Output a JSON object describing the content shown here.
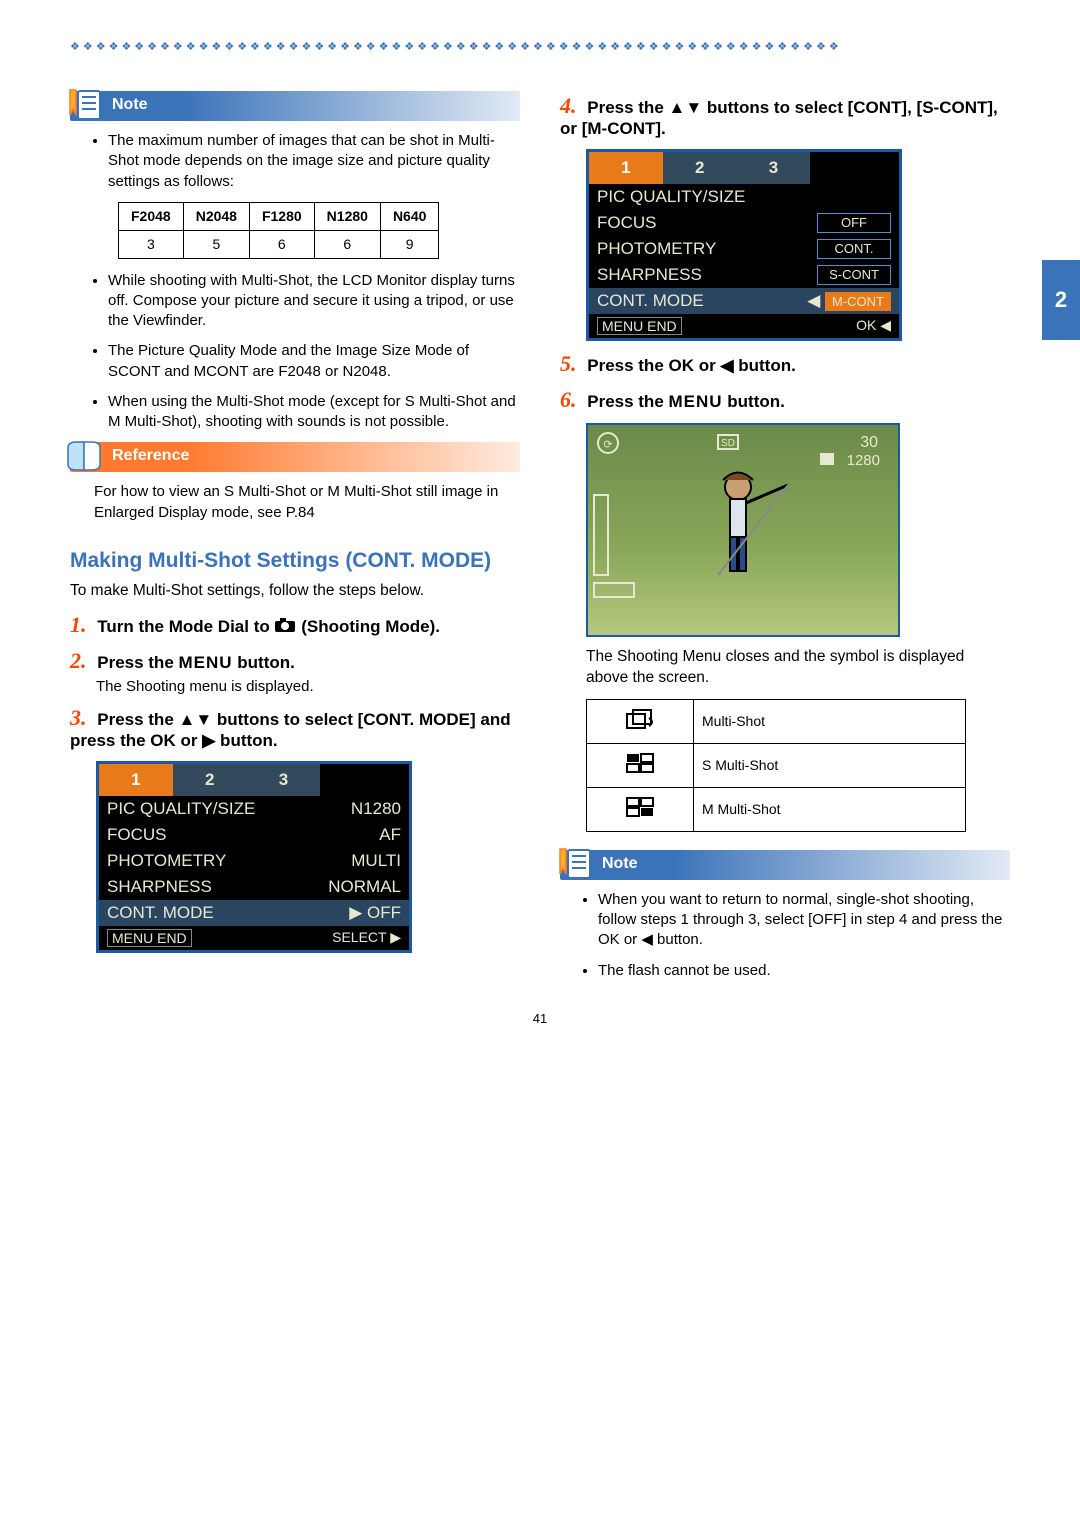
{
  "page_number": "41",
  "section_tab": "2",
  "note1": {
    "label": "Note",
    "items": [
      "The maximum number of images that can be shot in Multi-Shot mode depends on the image size and picture quality settings as follows:",
      "While shooting with Multi-Shot, the LCD Monitor display turns off. Compose your picture and secure it using a tripod, or use the Viewfinder.",
      "The Picture Quality Mode and the Image Size Mode of SCONT and MCONT are F2048 or N2048.",
      "When using the Multi-Shot mode (except for S Multi-Shot and M Multi-Shot), shooting with sounds is not possible."
    ],
    "table_headers": [
      "F2048",
      "N2048",
      "F1280",
      "N1280",
      "N640"
    ],
    "table_values": [
      "3",
      "5",
      "6",
      "6",
      "9"
    ]
  },
  "reference": {
    "label": "Reference",
    "text": "For how to view an S Multi-Shot or M Multi-Shot still image in Enlarged Display mode, see P.84"
  },
  "section_title": "Making Multi-Shot Settings (CONT. MODE)",
  "section_intro": "To make Multi-Shot settings, follow the steps below.",
  "steps": {
    "s1_pre": "Turn the Mode Dial to ",
    "s1_post": " (Shooting Mode).",
    "s2_pre": "Press the ",
    "s2_mid": "MENU",
    "s2_post": " button.",
    "s2_sub": "The Shooting menu is displayed.",
    "s3": "Press the ▲▼ buttons to select [CONT. MODE] and press the OK or ▶ button.",
    "s4": "Press the ▲▼ buttons to select [CONT], [S-CONT], or [M-CONT].",
    "s5": "Press the OK or ◀ button.",
    "s6_pre": "Press the ",
    "s6_mid": "MENU",
    "s6_post": " button."
  },
  "menu1": {
    "tabs": [
      "1",
      "2",
      "3"
    ],
    "rows": [
      {
        "l": "PIC QUALITY/SIZE",
        "r": "N1280"
      },
      {
        "l": "FOCUS",
        "r": "AF"
      },
      {
        "l": "PHOTOMETRY",
        "r": "MULTI"
      },
      {
        "l": "SHARPNESS",
        "r": "NORMAL"
      },
      {
        "l": "CONT. MODE",
        "r": "OFF",
        "hl": true,
        "arrow": "▶"
      }
    ],
    "footer_l": "MENU END",
    "footer_r": "SELECT ▶"
  },
  "menu2": {
    "tabs": [
      "1",
      "2",
      "3"
    ],
    "rows": [
      {
        "l": "PIC QUALITY/SIZE",
        "opts": [
          ""
        ]
      },
      {
        "l": "FOCUS",
        "opt": "OFF"
      },
      {
        "l": "PHOTOMETRY",
        "opt": "CONT."
      },
      {
        "l": "SHARPNESS",
        "opt": "S-CONT"
      },
      {
        "l": "CONT. MODE",
        "opt": "M-CONT",
        "hl": true,
        "arrow": "◀"
      }
    ],
    "footer_l": "MENU END",
    "footer_r": "OK ◀"
  },
  "preview_overlay": {
    "top_right": "30",
    "res": "1280"
  },
  "result_text": "The Shooting Menu closes and the symbol is displayed above the screen.",
  "icon_table": [
    "Multi-Shot",
    "S Multi-Shot",
    "M Multi-Shot"
  ],
  "note2": {
    "label": "Note",
    "items": [
      "When you want to return to normal, single-shot shooting, follow steps 1 through 3, select [OFF] in step 4 and press the OK or ◀ button.",
      "The flash cannot be used."
    ]
  }
}
